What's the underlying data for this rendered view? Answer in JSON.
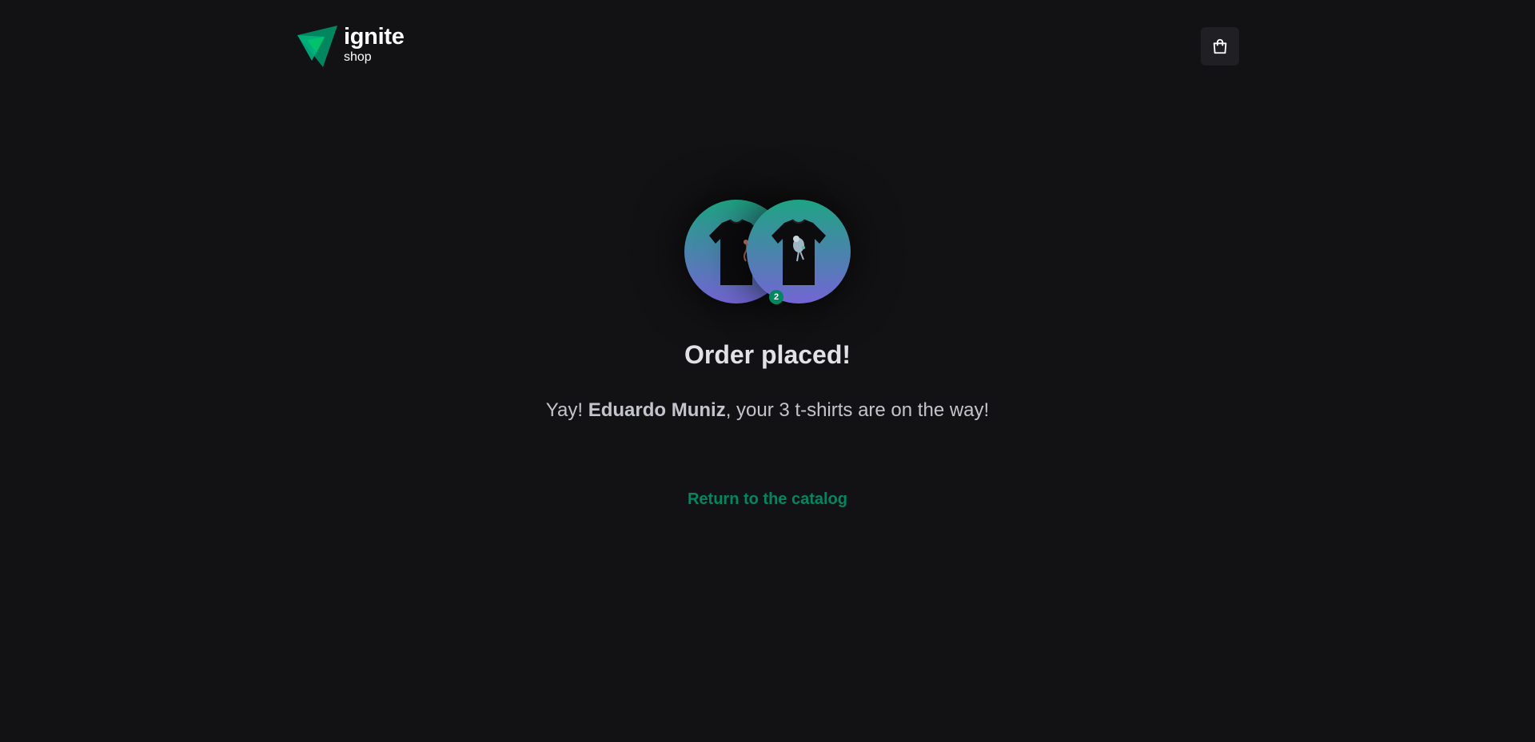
{
  "header": {
    "logo_title": "ignite",
    "logo_subtitle": "shop",
    "cart_icon": "shopping-bag-icon"
  },
  "order": {
    "badge_count": "2",
    "products": [
      {
        "icon": "t-shirt-image"
      },
      {
        "icon": "t-shirt-image"
      }
    ]
  },
  "success": {
    "title": "Order placed!",
    "message_prefix": "Yay! ",
    "customer_name": "Eduardo Muniz",
    "message_suffix": ", your 3 t-shirts are on the way!",
    "return_link": "Return to the catalog"
  },
  "colors": {
    "background": "#121214",
    "brand_green": "#00875f",
    "gradient_start": "#1ea483",
    "gradient_end": "#7465d4"
  }
}
